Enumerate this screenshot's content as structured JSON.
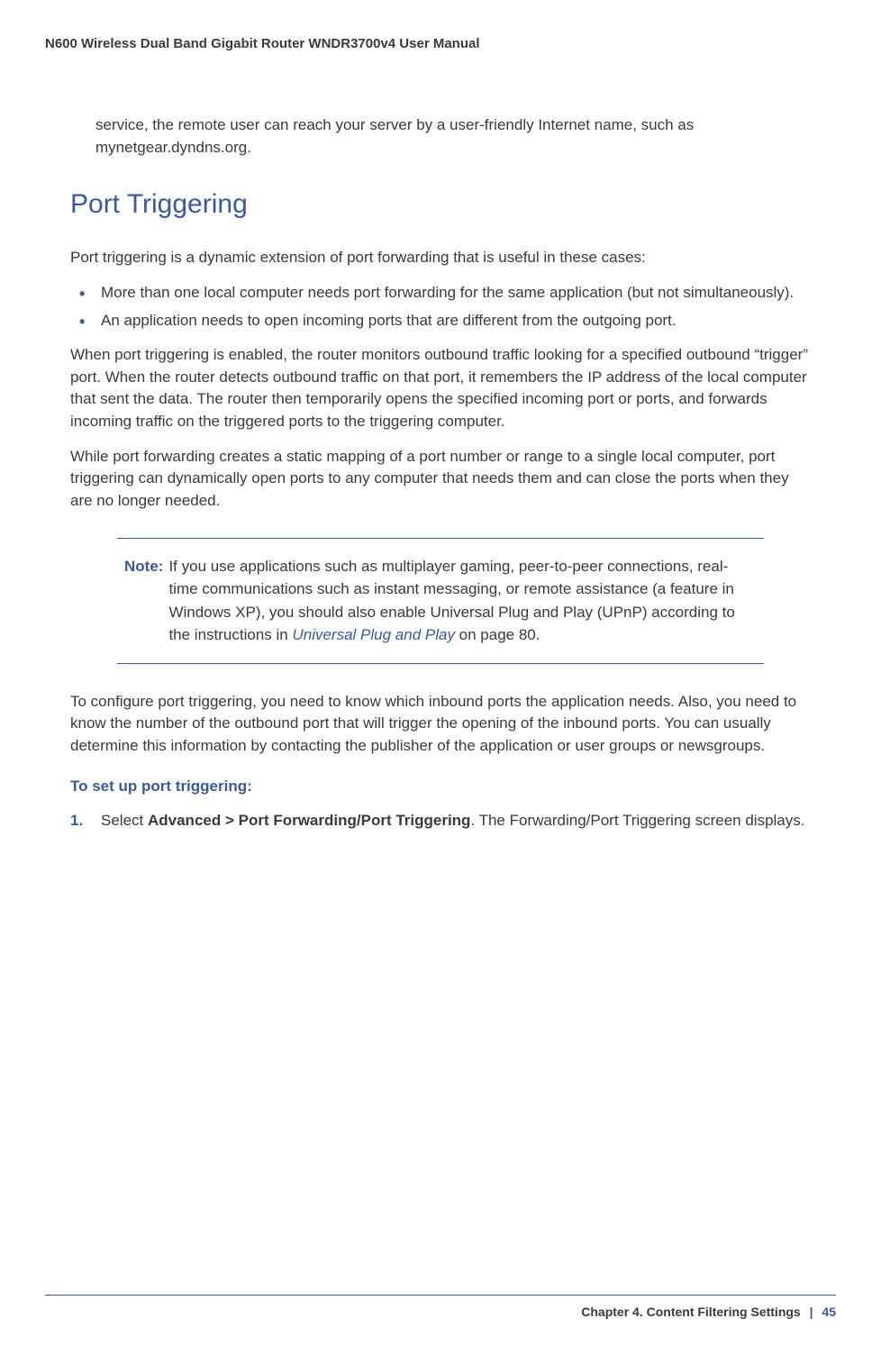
{
  "header": {
    "title": "N600 Wireless Dual Band Gigabit Router WNDR3700v4 User Manual"
  },
  "continuation": "service, the remote user can reach your server by a user-friendly Internet name, such as mynetgear.dyndns.org.",
  "section": {
    "heading": "Port Triggering"
  },
  "intro": "Port triggering is a dynamic extension of port forwarding that is useful in these cases:",
  "bullets": [
    "More than one local computer needs port forwarding for the same application (but not simultaneously).",
    "An application needs to open incoming ports that are different from the outgoing port."
  ],
  "para1": "When port triggering is enabled, the router monitors outbound traffic looking for a specified outbound “trigger” port. When the router detects outbound traffic on that port, it remembers the IP address of the local computer that sent the data. The router then temporarily opens the specified incoming port or ports, and forwards incoming traffic on the triggered ports to the triggering computer.",
  "para2": "While port forwarding creates a static mapping of a port number or range to a single local computer, port triggering can dynamically open ports to any computer that needs them and can close the ports when they are no longer needed.",
  "note": {
    "label": "Note:",
    "before_link": "If you use applications such as multiplayer gaming, peer-to-peer connections, real-time communications such as instant messaging, or remote assistance (a feature in Windows XP), you should also enable Universal Plug and Play (UPnP) according to the instructions in ",
    "link": "Universal Plug and Play",
    "after_link": " on page 80."
  },
  "para3": "To configure port triggering, you need to know which inbound ports the application needs. Also, you need to know the number of the outbound port that will trigger the opening of the inbound ports. You can usually determine this information by contacting the publisher of the application or user groups or newsgroups.",
  "subheading": "To set up port triggering:",
  "step1": {
    "num": "1.",
    "pre": "Select ",
    "bold": "Advanced > Port Forwarding/Port Triggering",
    "post": ". The Forwarding/Port Triggering screen displays."
  },
  "footer": {
    "chapter": "Chapter 4.  Content Filtering Settings",
    "sep": "|",
    "page": "45"
  }
}
